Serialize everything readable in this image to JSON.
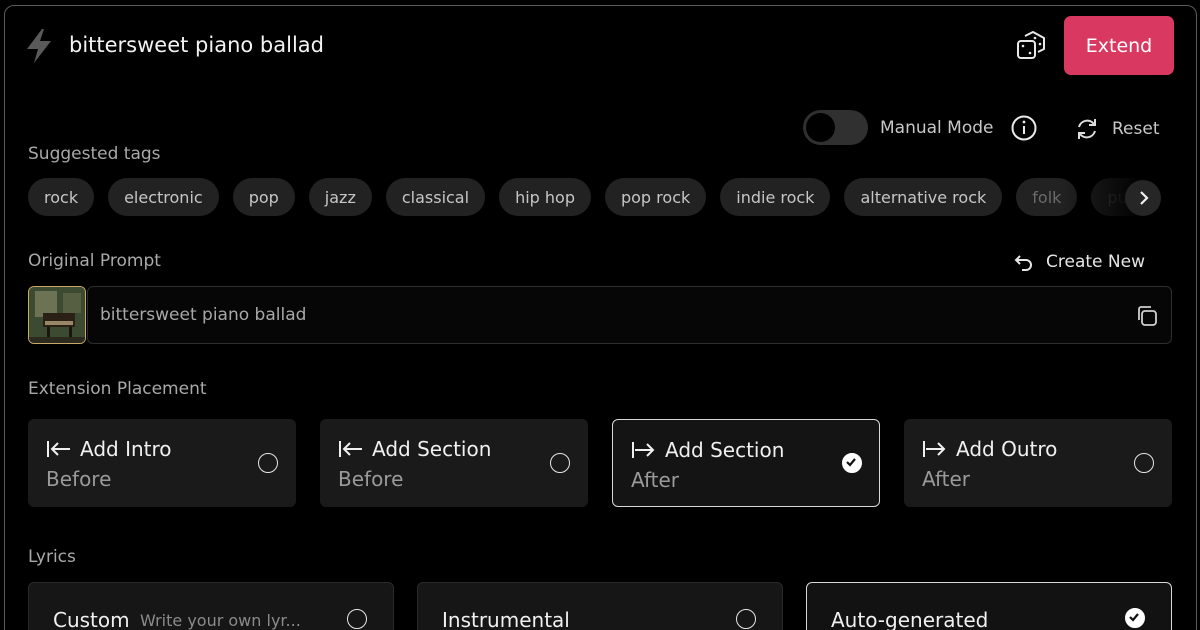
{
  "header": {
    "title": "bittersweet piano ballad",
    "extend_label": "Extend"
  },
  "controls": {
    "manual_mode_label": "Manual Mode",
    "manual_mode_on": false,
    "reset_label": "Reset"
  },
  "suggested_tags": {
    "label": "Suggested tags",
    "tags": [
      "rock",
      "electronic",
      "pop",
      "jazz",
      "classical",
      "hip hop",
      "pop rock",
      "indie rock",
      "alternative rock",
      "folk",
      "pun"
    ]
  },
  "original_prompt": {
    "label": "Original Prompt",
    "create_new_label": "Create New",
    "value": "bittersweet piano ballad"
  },
  "extension_placement": {
    "label": "Extension Placement",
    "options": [
      {
        "title": "Add Intro",
        "sub": "Before",
        "selected": false
      },
      {
        "title": "Add Section",
        "sub": "Before",
        "selected": false
      },
      {
        "title": "Add Section",
        "sub": "After",
        "selected": true
      },
      {
        "title": "Add Outro",
        "sub": "After",
        "selected": false
      }
    ]
  },
  "lyrics": {
    "label": "Lyrics",
    "options": [
      {
        "title": "Custom",
        "placeholder": "Write your own lyr...",
        "selected": false
      },
      {
        "title": "Instrumental",
        "selected": false
      },
      {
        "title": "Auto-generated",
        "selected": true
      }
    ]
  },
  "colors": {
    "accent": "#d93960",
    "background": "#000000"
  },
  "icons": [
    "lightning-icon",
    "dice-icon",
    "info-icon",
    "refresh-icon",
    "chevron-right-icon",
    "undo-icon",
    "copy-icon",
    "arrow-left-bar-icon",
    "arrow-right-bar-icon",
    "check-icon"
  ]
}
